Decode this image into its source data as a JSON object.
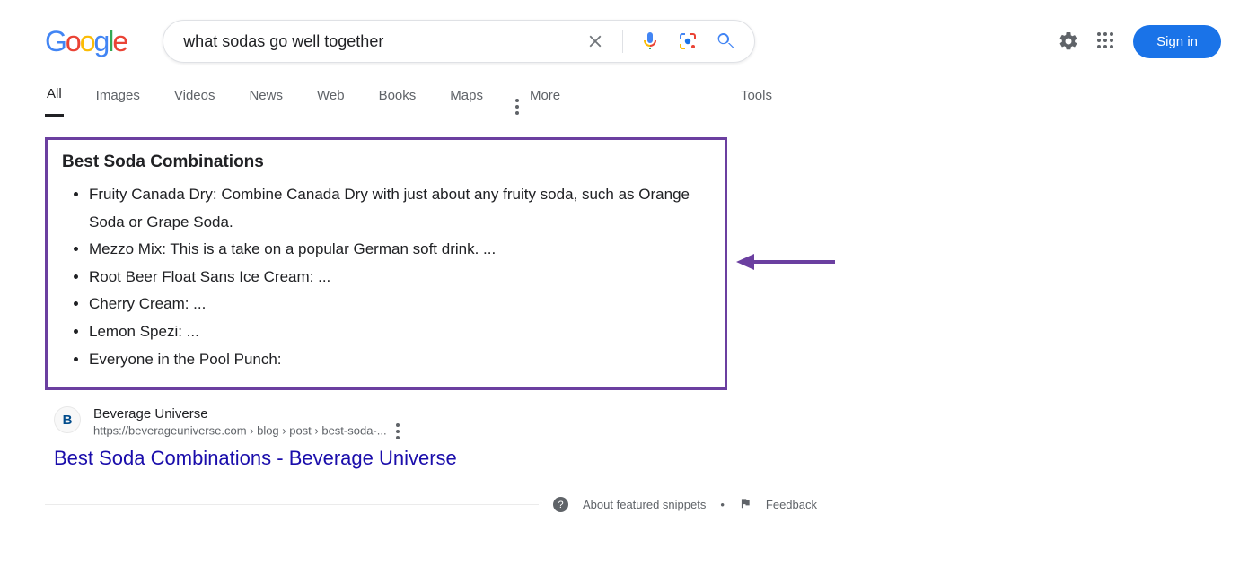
{
  "search": {
    "query": "what sodas go well together"
  },
  "signin_label": "Sign in",
  "tabs": {
    "all": "All",
    "images": "Images",
    "videos": "Videos",
    "news": "News",
    "web": "Web",
    "books": "Books",
    "maps": "Maps",
    "more": "More",
    "tools": "Tools"
  },
  "snippet": {
    "title": "Best Soda Combinations",
    "items": [
      "Fruity Canada Dry: Combine Canada Dry with just about any fruity soda, such as Orange Soda or Grape Soda.",
      "Mezzo Mix: This is a take on a popular German soft drink. ...",
      "Root Beer Float Sans Ice Cream: ...",
      "Cherry Cream: ...",
      "Lemon Spezi: ...",
      "Everyone in the Pool Punch:"
    ]
  },
  "source": {
    "name": "Beverage Universe",
    "url": "https://beverageuniverse.com › blog › post › best-soda-...",
    "favicon_letter": "B"
  },
  "result_title": "Best Soda Combinations - Beverage Universe",
  "footer": {
    "about": "About featured snippets",
    "feedback": "Feedback"
  },
  "annotation": {
    "arrow_color": "#6b3fa0",
    "box_color": "#6b3fa0"
  }
}
